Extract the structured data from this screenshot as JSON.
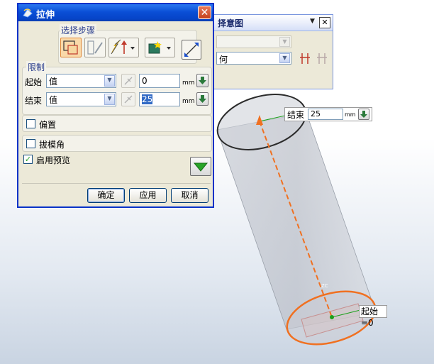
{
  "dialog": {
    "title": "拉伸",
    "select_steps_label": "选择步骤",
    "limit_label": "限制",
    "start": {
      "label": "起始",
      "type": "值",
      "value": "0",
      "unit": "mm"
    },
    "end": {
      "label": "结束",
      "type": "值",
      "value": "25",
      "unit": "mm"
    },
    "offset_label": "偏置",
    "draft_label": "拔模角",
    "preview_label": "启用预览",
    "ok_label": "确定",
    "apply_label": "应用",
    "cancel_label": "取消",
    "close_glyph": "✕"
  },
  "background_window": {
    "title_fragment": "择意图",
    "combo1_value": "",
    "combo2_value": "何"
  },
  "canvas": {
    "end_handle": {
      "label": "结束",
      "value": "25",
      "unit": "mm"
    },
    "start_label": "起始=0",
    "axis_label": "ZC"
  },
  "colors": {
    "titlebar": "#0a4fd6",
    "preview_orange": "#f07020",
    "highlight": "#f6b060"
  }
}
